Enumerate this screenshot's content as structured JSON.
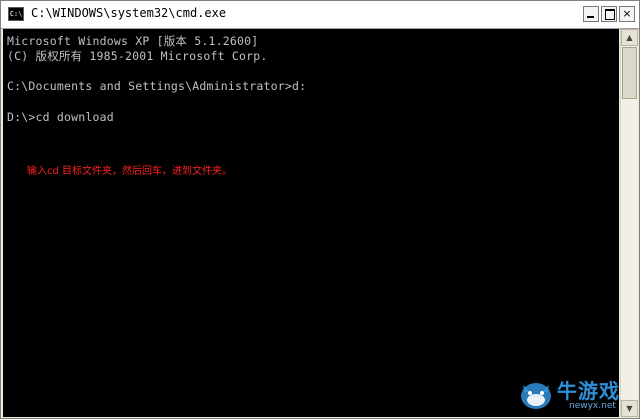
{
  "window": {
    "title": "C:\\WINDOWS\\system32\\cmd.exe",
    "icon": "cmd-app-icon",
    "icon_text": "C:\\",
    "buttons": [
      "minimize",
      "maximize",
      "close"
    ],
    "close_label": "×"
  },
  "console": {
    "lines": [
      "Microsoft Windows XP [版本 5.1.2600]",
      "(C) 版权所有 1985-2001 Microsoft Corp.",
      "",
      "C:\\Documents and Settings\\Administrator>d:",
      "",
      "D:\\>cd download"
    ],
    "note": "输入cd 目标文件夹，然后回车，进到文件夹。",
    "colors": {
      "background": "#000000",
      "text": "#c0c0c0",
      "note": "#ff2020"
    }
  },
  "scrollbar": {
    "up_arrow": "▲",
    "down_arrow": "▼"
  },
  "watermark": {
    "title": "牛游戏",
    "url": "newyx.net"
  }
}
